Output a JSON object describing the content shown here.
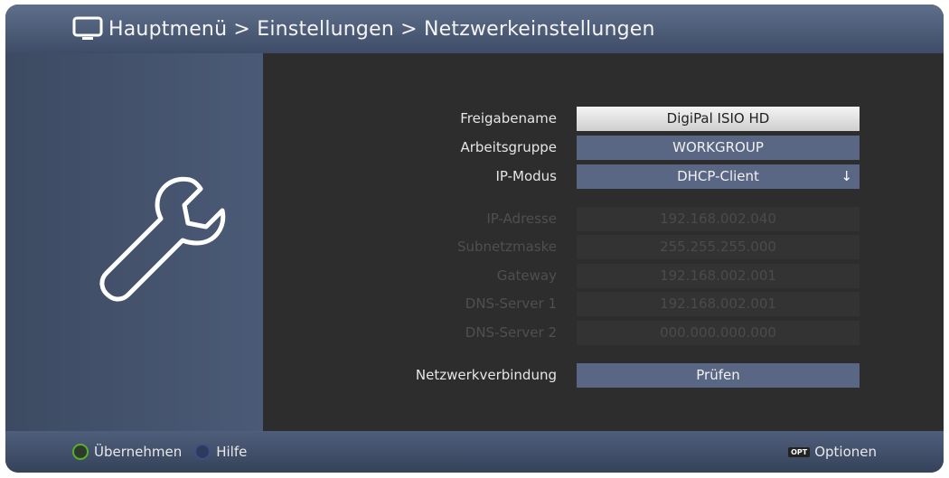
{
  "header": {
    "title": "Hauptmenü > Einstellungen > Netzwerkeinstellungen",
    "icon": "tv-icon"
  },
  "side_panel": {
    "icon": "wrench-icon"
  },
  "form": {
    "share_name": {
      "label": "Freigabename",
      "value": "DigiPal ISIO HD"
    },
    "workgroup": {
      "label": "Arbeitsgruppe",
      "value": "WORKGROUP"
    },
    "ip_mode": {
      "label": "IP-Modus",
      "value": "DHCP-Client",
      "arrow": "↓"
    },
    "ip_address": {
      "label": "IP-Adresse",
      "value": "192.168.002.040"
    },
    "subnet_mask": {
      "label": "Subnetzmaske",
      "value": "255.255.255.000"
    },
    "gateway": {
      "label": "Gateway",
      "value": "192.168.002.001"
    },
    "dns1": {
      "label": "DNS-Server 1",
      "value": "192.168.002.001"
    },
    "dns2": {
      "label": "DNS-Server 2",
      "value": "000.000.000.000"
    },
    "network_connection": {
      "label": "Netzwerkverbindung",
      "value": "Prüfen"
    }
  },
  "footer": {
    "accept": "Übernehmen",
    "help": "Hilfe",
    "opt_badge": "OPT",
    "options": "Optionen"
  },
  "colors": {
    "header_bg": "#4f5e7b",
    "field_bg": "#5a6784",
    "selected_field_bg": "#e8e8e8",
    "green_key": "#56b02e",
    "blue_key": "#3c4f86"
  }
}
